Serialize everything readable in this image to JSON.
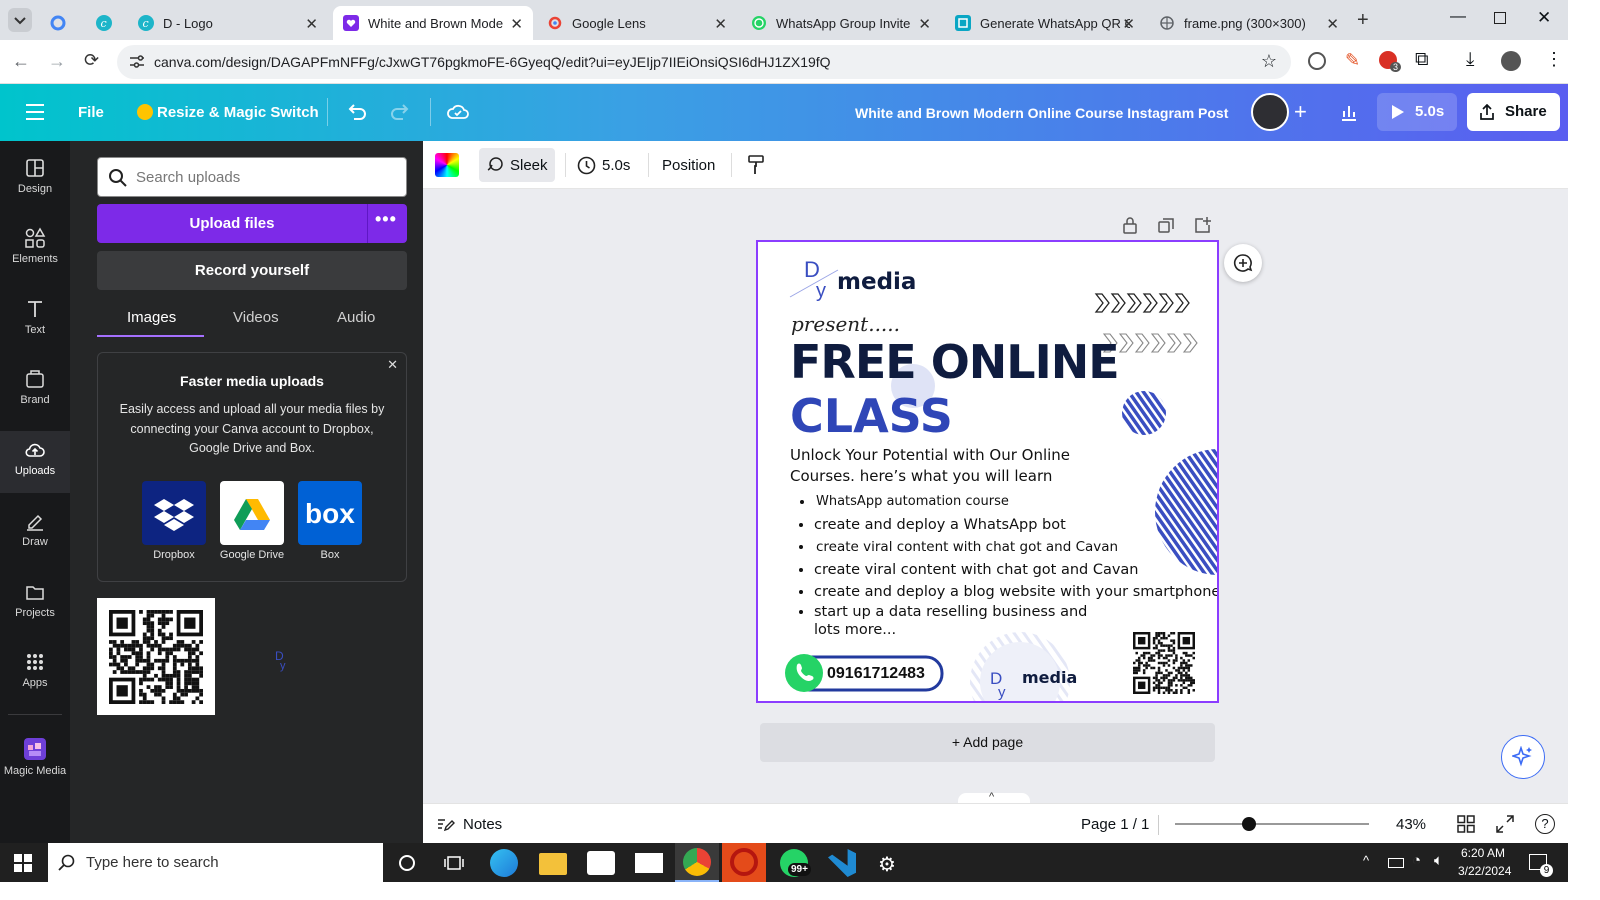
{
  "browser": {
    "tabs": [
      {
        "label": "",
        "icon": "google-icon"
      },
      {
        "label": "",
        "icon": "canva-icon"
      },
      {
        "label": "D - Logo",
        "icon": "canva-icon"
      },
      {
        "label": "White and Brown Modern",
        "icon": "canva-heart-icon",
        "active": true
      },
      {
        "label": "Google Lens",
        "icon": "google-lens-icon"
      },
      {
        "label": "WhatsApp Group Invite",
        "icon": "whatsapp-icon"
      },
      {
        "label": "Generate WhatsApp QR C",
        "icon": "qr-icon"
      },
      {
        "label": "frame.png (300×300)",
        "icon": "globe-icon"
      }
    ],
    "url": "canva.com/design/DAGAPFmNFFg/cJxwGT76pgkmoFE-6GyeqQ/edit?ui=eyJEIjp7IIEiOnsiQSI6dHJ1ZX19fQ",
    "extension_badge": "3"
  },
  "header": {
    "file_label": "File",
    "resize_label": "Resize & Magic Switch",
    "title": "White and Brown Modern Online Course Instagram Post",
    "play_label": "5.0s",
    "share_label": "Share"
  },
  "rail": [
    {
      "label": "Design",
      "icon": "design-icon"
    },
    {
      "label": "Elements",
      "icon": "elements-icon"
    },
    {
      "label": "Text",
      "icon": "text-icon"
    },
    {
      "label": "Brand",
      "icon": "brand-icon"
    },
    {
      "label": "Uploads",
      "icon": "uploads-icon",
      "active": true
    },
    {
      "label": "Draw",
      "icon": "draw-icon"
    },
    {
      "label": "Projects",
      "icon": "projects-icon"
    },
    {
      "label": "Apps",
      "icon": "apps-icon"
    },
    {
      "label": "Magic Media",
      "icon": "magic-media-icon"
    }
  ],
  "panel": {
    "search_placeholder": "Search uploads",
    "upload_label": "Upload files",
    "record_label": "Record yourself",
    "tabs": [
      "Images",
      "Videos",
      "Audio"
    ],
    "card": {
      "title": "Faster media uploads",
      "body": "Easily access and upload all your media files by connecting your Canva account to Dropbox, Google Drive and Box.",
      "services": [
        "Dropbox",
        "Google Drive",
        "Box"
      ]
    }
  },
  "toolbar": {
    "animation_label": "Sleek",
    "duration_label": "5.0s",
    "position_label": "Position"
  },
  "design": {
    "logo_top": "media",
    "present": "present.....",
    "headline1": "FREE ONLINE",
    "headline2": "CLASS",
    "intro": "Unlock Your Potential with Our Online Courses. here’s what you will learn",
    "bullets": [
      "WhatsApp automation course",
      "create and  deploy a WhatsApp bot",
      "create viral content with chat got and Cavan",
      " create viral content with chat got and Cavan",
      "create and deploy a blog website with your smartphone",
      "start up a data reselling business and lots more..."
    ],
    "phone": "09161712483",
    "logo_bottom": "media",
    "add_page": "+ Add page"
  },
  "footer": {
    "notes_label": "Notes",
    "page_label": "Page 1 / 1",
    "zoom_label": "43%",
    "zoom_fraction": 0.38
  },
  "taskbar": {
    "search_placeholder": "Type here to search",
    "time": "6:20 AM",
    "date": "3/22/2024",
    "notification_count": "9",
    "whatsapp_badge": "99+"
  },
  "colors": {
    "canva_purple": "#7d2ae8",
    "design_navy": "#0f1c3f",
    "design_blue": "#3a4ec1",
    "whatsapp_green": "#25d366"
  }
}
